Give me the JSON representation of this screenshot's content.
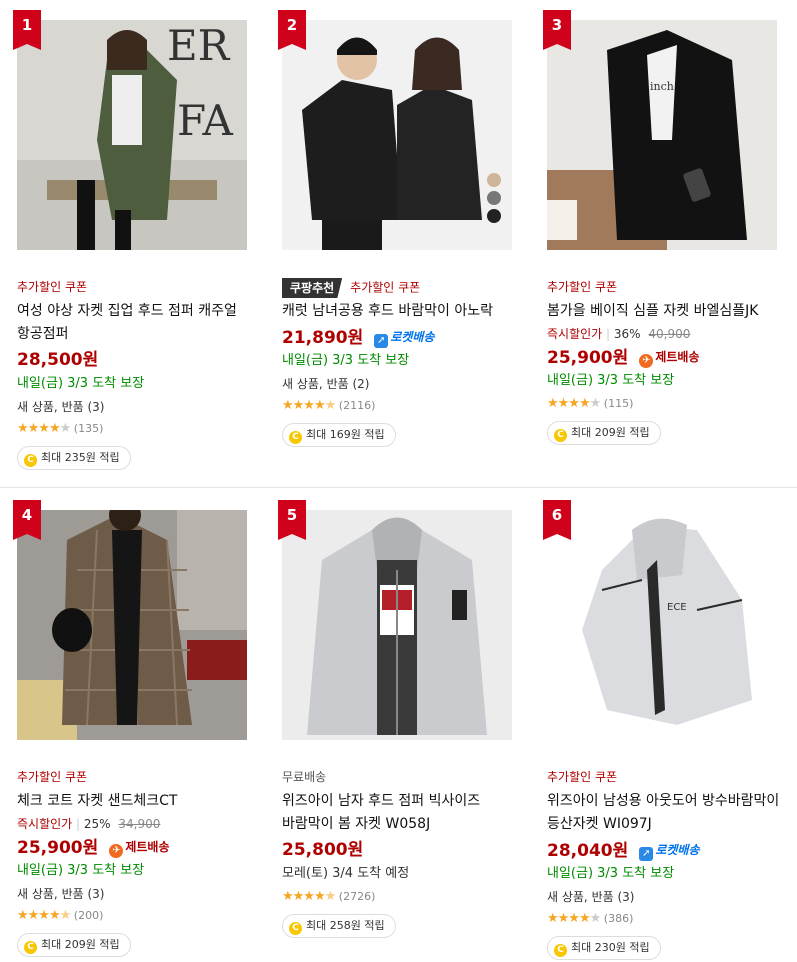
{
  "products": [
    {
      "rank": "1",
      "coupon": "추가할인 쿠폰",
      "name": "여성 야상 자켓 집업 후드 점퍼 캐주얼 항공점퍼",
      "price": "28,500원",
      "arrival": "내일(금) 3/3 도착 보장",
      "returns": "새 상품, 반품 (3)",
      "rating": 4,
      "review_count": "(135)",
      "reward": "최대 235원 적립"
    },
    {
      "rank": "2",
      "badge": "쿠팡추천",
      "coupon": "추가할인 쿠폰",
      "name": "캐럿 남녀공용 후드 바람막이 아노락",
      "price": "21,890원",
      "shipping": "로켓배송",
      "arrival": "내일(금) 3/3 도착 보장",
      "returns": "새 상품, 반품 (2)",
      "rating": 4.5,
      "review_count": "(2116)",
      "reward": "최대 169원 적립"
    },
    {
      "rank": "3",
      "coupon": "추가할인 쿠폰",
      "name": "봄가을 베이직 심플 자켓 바엘심플JK",
      "instant_discount": "즉시할인가",
      "discount_pct": "36%",
      "original_price": "40,900",
      "price": "25,900원",
      "shipping": "제트배송",
      "arrival": "내일(금) 3/3 도착 보장",
      "rating": 4,
      "review_count": "(115)",
      "reward": "최대 209원 적립"
    },
    {
      "rank": "4",
      "coupon": "추가할인 쿠폰",
      "name": "체크 코트 자켓 샌드체크CT",
      "instant_discount": "즉시할인가",
      "discount_pct": "25%",
      "original_price": "34,900",
      "price": "25,900원",
      "shipping": "제트배송",
      "arrival": "내일(금) 3/3 도착 보장",
      "returns": "새 상품, 반품 (3)",
      "rating": 4.5,
      "review_count": "(200)",
      "reward": "최대 209원 적립"
    },
    {
      "rank": "5",
      "coupon": "무료배송",
      "name": "위즈아이 남자 후드 점퍼 빅사이즈 바람막이 봄 자켓 W058J",
      "price": "25,800원",
      "arrival": "모레(토) 3/4 도착 예정",
      "rating": 4.5,
      "review_count": "(2726)",
      "reward": "최대 258원 적립"
    },
    {
      "rank": "6",
      "coupon": "추가할인 쿠폰",
      "name": "위즈아이 남성용 아웃도어 방수바람막이 등산자켓 WI097J",
      "price": "28,040원",
      "shipping": "로켓배송",
      "arrival": "내일(금) 3/3 도착 보장",
      "returns": "새 상품, 반품 (3)",
      "rating": 4,
      "review_count": "(386)",
      "reward": "최대 230원 적립"
    }
  ],
  "colors": {
    "accent_red": "#ae0000",
    "rank_red": "#d0011b",
    "arrive_green": "#008c00",
    "rocket_blue": "#0073e9",
    "star": "#f5a623"
  },
  "icons": {
    "rocket": "rocket-icon",
    "jet": "jet-delivery-icon",
    "reward": "coin-icon"
  }
}
